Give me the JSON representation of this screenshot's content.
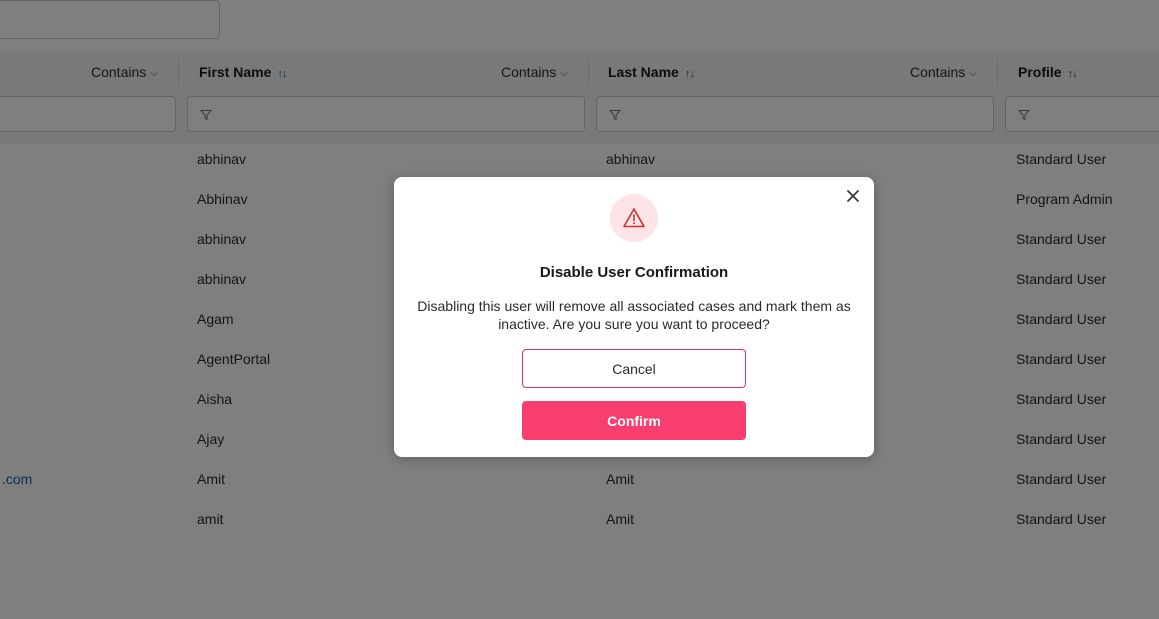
{
  "table": {
    "columns": [
      {
        "filter_mode": "Contains"
      },
      {
        "title": "First Name",
        "filter_mode": "Contains"
      },
      {
        "title": "Last Name",
        "filter_mode": "Contains"
      },
      {
        "title": "Profile"
      }
    ],
    "rows": [
      {
        "email": "",
        "first_name": "abhinav",
        "last_name": "abhinav",
        "profile": "Standard User"
      },
      {
        "email": "",
        "first_name": "Abhinav",
        "last_name": "",
        "profile": "Program Admin"
      },
      {
        "email": "",
        "first_name": "abhinav",
        "last_name": "",
        "profile": "Standard User"
      },
      {
        "email": "",
        "first_name": "abhinav",
        "last_name": "",
        "profile": "Standard User"
      },
      {
        "email": "",
        "first_name": "Agam",
        "last_name": "",
        "profile": "Standard User"
      },
      {
        "email": "",
        "first_name": "AgentPortal",
        "last_name": "",
        "profile": "Standard User"
      },
      {
        "email": "",
        "first_name": "Aisha",
        "last_name": "",
        "profile": "Standard User"
      },
      {
        "email": "",
        "first_name": "Ajay",
        "last_name": "",
        "profile": "Standard User"
      },
      {
        "email": ".com",
        "first_name": "Amit",
        "last_name": "Amit",
        "profile": "Standard User"
      },
      {
        "email": "",
        "first_name": "amit",
        "last_name": "Amit",
        "profile": "Standard User"
      }
    ]
  },
  "icons": {
    "sort": "sort-arrows-icon",
    "filter": "filter-funnel-icon",
    "warning": "warning-triangle-icon",
    "close": "close-x-icon",
    "chevron": "chevron-down-icon"
  },
  "modal": {
    "title": "Disable User Confirmation",
    "message": "Disabling this user will remove all associated cases and mark them as inactive. Are you sure you want to proceed?",
    "cancel_label": "Cancel",
    "confirm_label": "Confirm"
  },
  "colors": {
    "accent": "#0b5cab",
    "confirm_button": "#f83e6f",
    "cancel_border": "#d4307f",
    "warning": "#d0312d",
    "warning_bg": "#fde4e6"
  }
}
